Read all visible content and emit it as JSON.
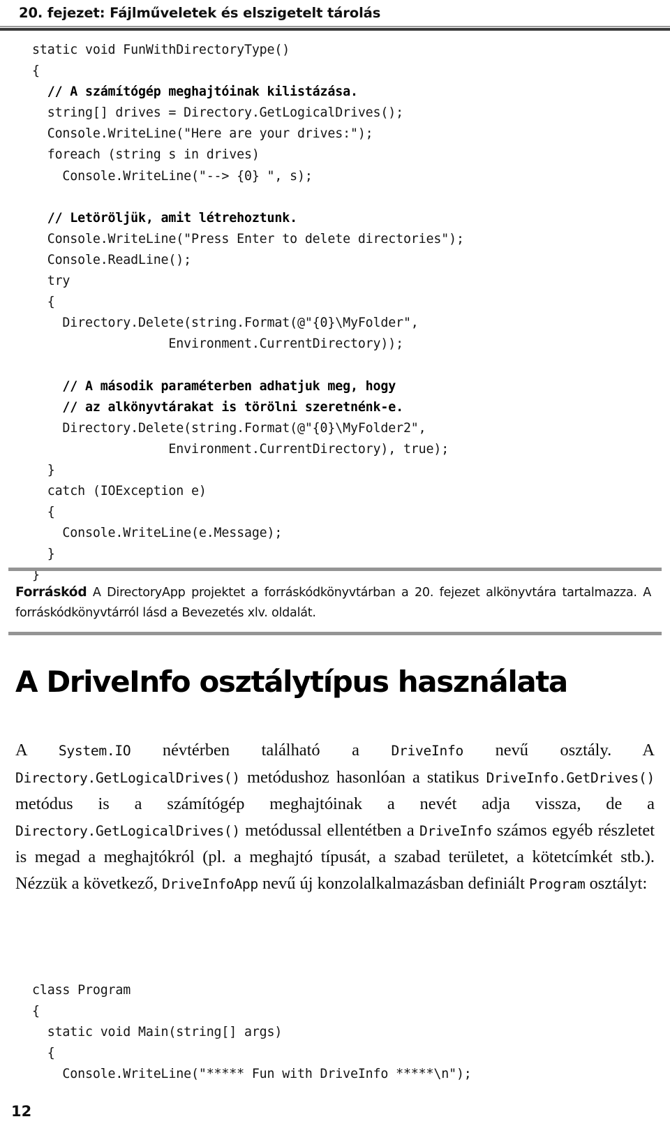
{
  "header": {
    "chapter_title": "20. fejezet: Fájlműveletek és elszigetelt tárolás",
    "rule_color": "#3a3a3a"
  },
  "code_listing_1": {
    "language": "csharp",
    "lines": [
      {
        "text": "static void FunWithDirectoryType()",
        "comment": false
      },
      {
        "text": "{",
        "comment": false
      },
      {
        "text": "  // A számítógép meghajtóinak kilistázása.",
        "comment": true
      },
      {
        "text": "  string[] drives = Directory.GetLogicalDrives();",
        "comment": false
      },
      {
        "text": "  Console.WriteLine(\"Here are your drives:\");",
        "comment": false
      },
      {
        "text": "  foreach (string s in drives)",
        "comment": false
      },
      {
        "text": "    Console.WriteLine(\"--> {0} \", s);",
        "comment": false
      },
      {
        "text": "",
        "comment": false
      },
      {
        "text": "  // Letöröljük, amit létrehoztunk.",
        "comment": true
      },
      {
        "text": "  Console.WriteLine(\"Press Enter to delete directories\");",
        "comment": false
      },
      {
        "text": "  Console.ReadLine();",
        "comment": false
      },
      {
        "text": "  try",
        "comment": false
      },
      {
        "text": "  {",
        "comment": false
      },
      {
        "text": "    Directory.Delete(string.Format(@\"{0}\\MyFolder\",",
        "comment": false
      },
      {
        "text": "                  Environment.CurrentDirectory));",
        "comment": false
      },
      {
        "text": "",
        "comment": false
      },
      {
        "text": "    // A második paraméterben adhatjuk meg, hogy",
        "comment": true
      },
      {
        "text": "    // az alkönyvtárakat is törölni szeretnénk-e.",
        "comment": true
      },
      {
        "text": "    Directory.Delete(string.Format(@\"{0}\\MyFolder2\",",
        "comment": false
      },
      {
        "text": "                  Environment.CurrentDirectory), true);",
        "comment": false
      },
      {
        "text": "  }",
        "comment": false
      },
      {
        "text": "  catch (IOException e)",
        "comment": false
      },
      {
        "text": "  {",
        "comment": false
      },
      {
        "text": "    Console.WriteLine(e.Message);",
        "comment": false
      },
      {
        "text": "  }",
        "comment": false
      },
      {
        "text": "}",
        "comment": false
      }
    ]
  },
  "source_note": {
    "label": "Forráskód",
    "text": " A DirectoryApp projektet a forráskódkönyvtárban a 20. fejezet alkönyvtára tartalmazza. A forráskódkönyvtárról lásd a Bevezetés xlv. oldalát.",
    "rule_color": "#949494"
  },
  "section": {
    "heading": "A DriveInfo osztálytípus használata"
  },
  "body_paragraph": {
    "segments": [
      {
        "text": "A ",
        "mono": false
      },
      {
        "text": "System.IO",
        "mono": true
      },
      {
        "text": " névtérben található a ",
        "mono": false
      },
      {
        "text": "DriveInfo",
        "mono": true
      },
      {
        "text": " nevű osztály. A ",
        "mono": false
      },
      {
        "text": "Directory.GetLogicalDrives()",
        "mono": true
      },
      {
        "text": " metódushoz hasonlóan a statikus ",
        "mono": false
      },
      {
        "text": "DriveInfo.GetDrives()",
        "mono": true
      },
      {
        "text": " metódus is a számítógép meghajtóinak a nevét adja vissza, de a ",
        "mono": false
      },
      {
        "text": "Directory.GetLogicalDrives()",
        "mono": true
      },
      {
        "text": " metódussal ellentétben a ",
        "mono": false
      },
      {
        "text": "DriveInfo",
        "mono": true
      },
      {
        "text": " számos egyéb részletet is megad a meghajtókról (pl. a meghajtó típusát, a szabad területet, a kötetcímkét stb.). Nézzük a következő, ",
        "mono": false
      },
      {
        "text": "DriveInfoApp",
        "mono": true
      },
      {
        "text": " nevű új konzolalkalmazásban definiált ",
        "mono": false
      },
      {
        "text": "Program",
        "mono": true
      },
      {
        "text": " osztályt:",
        "mono": false
      }
    ]
  },
  "code_listing_2": {
    "language": "csharp",
    "lines": [
      {
        "text": "class Program",
        "comment": false
      },
      {
        "text": "{",
        "comment": false
      },
      {
        "text": "  static void Main(string[] args)",
        "comment": false
      },
      {
        "text": "  {",
        "comment": false
      },
      {
        "text": "    Console.WriteLine(\"***** Fun with DriveInfo *****\\n\");",
        "comment": false
      }
    ]
  },
  "folio": {
    "page_number": "12"
  }
}
